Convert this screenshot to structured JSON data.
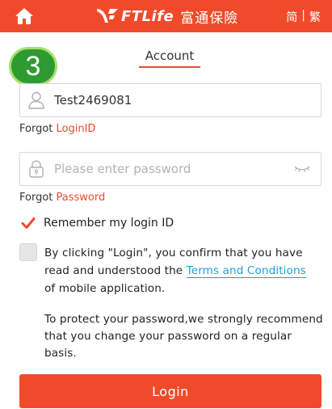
{
  "header": {
    "brand_en": "FTLife",
    "brand_cn": "富通保險",
    "lang_simplified": "简",
    "lang_separator": "|",
    "lang_traditional": "繁",
    "color_bar": "#ef4b2b"
  },
  "step_badge": "3",
  "tab": {
    "label": "Account"
  },
  "login_id": {
    "value": "Test2469081",
    "icon": "user-icon"
  },
  "forgot_id": {
    "prefix": "Forgot ",
    "link": "LoginID"
  },
  "password": {
    "placeholder": "Please enter password",
    "icon": "lock-icon",
    "toggle_icon": "eye-closed-icon"
  },
  "forgot_pw": {
    "prefix": "Forgot ",
    "link": "Password"
  },
  "remember": {
    "label": "Remember my login ID",
    "checked": true
  },
  "terms": {
    "before": "By clicking \"Login\", you confirm that you have read and understood the ",
    "link": "Terms and Conditions",
    "after": " of mobile application.",
    "checked": false
  },
  "note": "To protect your password,we strongly recommend that you change your password on a regular basis.",
  "login_button": "Login",
  "colors": {
    "accent": "#ef4b2b",
    "link": "#1f9de0",
    "badge": "#2e9b32"
  }
}
